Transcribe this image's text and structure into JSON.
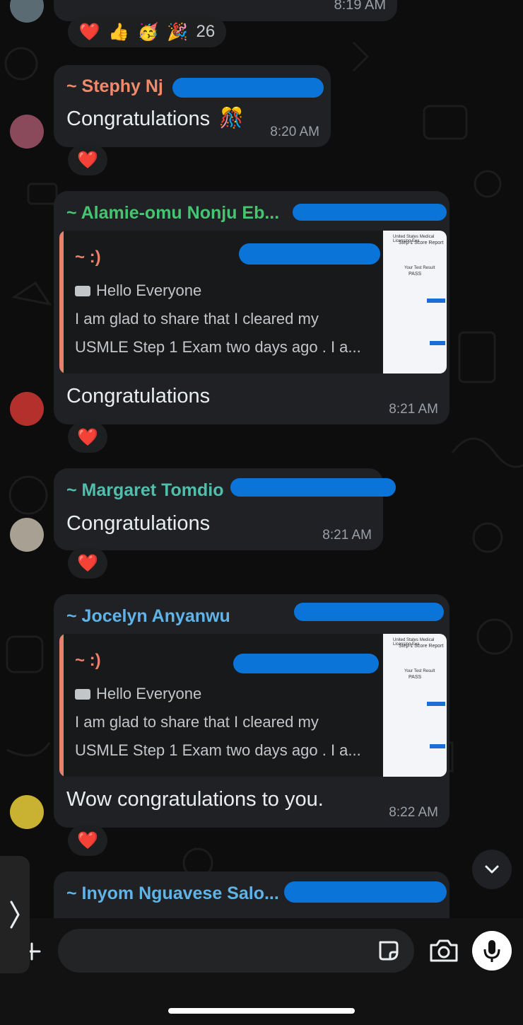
{
  "top_message": {
    "time": "8:19 AM",
    "reaction_count": "26",
    "reaction_emojis": [
      "❤️",
      "👍",
      "🥳",
      "🎉"
    ]
  },
  "messages": [
    {
      "sender": "~ Stephy Nj",
      "text": "Congratulations",
      "emoji": "🎊",
      "time": "8:20 AM",
      "reaction": "❤️",
      "sender_color": "#f08a6b"
    },
    {
      "sender": "~ Alamie-omu Nonju Eb...",
      "quote_sender": "~ :)",
      "quote_line1": "Hello Everyone",
      "quote_line2": "I am glad to share that I cleared my",
      "quote_line3": "USMLE Step 1 Exam two days ago  . I a...",
      "text": "Congratulations",
      "time": "8:21 AM",
      "reaction": "❤️",
      "sender_color": "#47c472"
    },
    {
      "sender": "~ Margaret Tomdio",
      "text": "Congratulations",
      "time": "8:21 AM",
      "reaction": "❤️",
      "sender_color": "#53bdac"
    },
    {
      "sender": "~ Jocelyn Anyanwu",
      "quote_sender": "~ :)",
      "quote_line1": "Hello Everyone",
      "quote_line2": "I am glad to share that I cleared my",
      "quote_line3": "USMLE Step 1 Exam two days ago  . I a...",
      "text": "Wow congratulations to you.",
      "time": "8:22 AM",
      "reaction": "❤️",
      "sender_color": "#5fb3e6"
    },
    {
      "sender": "~ Inyom Nguavese Salo...",
      "sender_color": "#5fb3e6"
    }
  ],
  "thumbnail": {
    "line1": "United States Medical Licensing Exa",
    "line2": "Step 1 Score Report",
    "line3": "Your Test Result",
    "line4": "PASS"
  },
  "icons": {
    "sticker": "sticker-icon",
    "camera": "camera-icon",
    "mic": "microphone-icon",
    "plus": "plus-icon",
    "scroll": "chevron-down-icon",
    "side": "chevron-right-icon"
  }
}
